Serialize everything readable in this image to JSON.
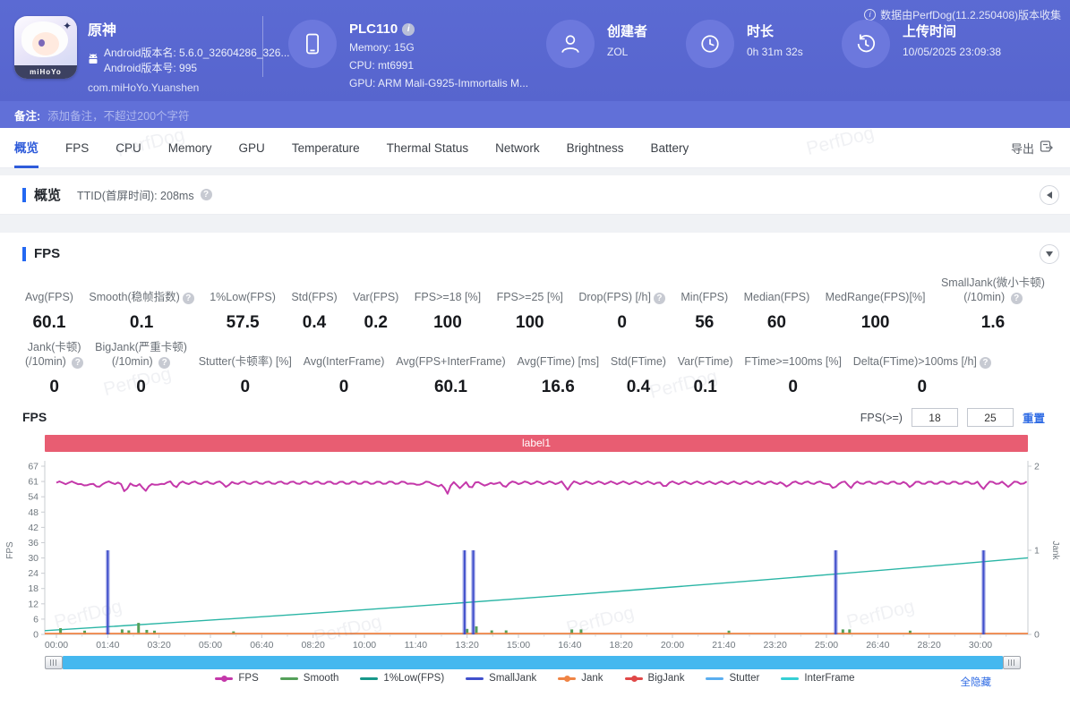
{
  "header": {
    "app": {
      "name": "原神",
      "version_name": "Android版本名: 5.6.0_32604286_326...",
      "version_code": "Android版本号: 995",
      "package": "com.miHoYo.Yuanshen",
      "icon_text": "miHoYo"
    },
    "device": {
      "name": "PLC110",
      "memory": "Memory: 15G",
      "cpu": "CPU: mt6991",
      "gpu": "GPU: ARM Mali-G925-Immortalis M..."
    },
    "creator": {
      "label": "创建者",
      "value": "ZOL"
    },
    "duration": {
      "label": "时长",
      "value": "0h 31m 32s"
    },
    "upload_time": {
      "label": "上传时间",
      "value": "10/05/2025 23:09:38"
    },
    "version_note": "数据由PerfDog(11.2.250408)版本收集"
  },
  "note_bar": {
    "label": "备注:",
    "placeholder": "添加备注，不超过200个字符"
  },
  "tab_bar": {
    "tabs": [
      "概览",
      "FPS",
      "CPU",
      "Memory",
      "GPU",
      "Temperature",
      "Thermal Status",
      "Network",
      "Brightness",
      "Battery"
    ],
    "export_label": "导出"
  },
  "overview": {
    "title": "概览",
    "ttid": "TTID(首屏时间): 208ms"
  },
  "fps": {
    "title": "FPS",
    "chart_title": "FPS",
    "threshold_label": "FPS(>=)",
    "threshold1": "18",
    "threshold2": "25",
    "reset_label": "重置",
    "banner": "label1",
    "hide_all": "全隐藏",
    "metrics_row1": [
      {
        "label": "Avg(FPS)",
        "value": "60.1"
      },
      {
        "label": "Smooth(稳帧指数)",
        "value": "0.1",
        "help": true
      },
      {
        "label": "1%Low(FPS)",
        "value": "57.5"
      },
      {
        "label": "Std(FPS)",
        "value": "0.4"
      },
      {
        "label": "Var(FPS)",
        "value": "0.2"
      },
      {
        "label": "FPS>=18 [%]",
        "value": "100"
      },
      {
        "label": "FPS>=25 [%]",
        "value": "100"
      },
      {
        "label": "Drop(FPS) [/h]",
        "value": "0",
        "help": true
      },
      {
        "label": "Min(FPS)",
        "value": "56"
      },
      {
        "label": "Median(FPS)",
        "value": "60"
      },
      {
        "label": "MedRange(FPS)[%]",
        "value": "100"
      },
      {
        "label": "SmallJank(微小卡顿)",
        "label2": "(/10min)",
        "value": "1.6",
        "help": true
      }
    ],
    "metrics_row2": [
      {
        "label": "Jank(卡顿)",
        "label2": "(/10min)",
        "value": "0",
        "help": true
      },
      {
        "label": "BigJank(严重卡顿)",
        "label2": "(/10min)",
        "value": "0",
        "help": true
      },
      {
        "label": "Stutter(卡顿率) [%]",
        "value": "0"
      },
      {
        "label": "Avg(InterFrame)",
        "value": "0"
      },
      {
        "label": "Avg(FPS+InterFrame)",
        "value": "60.1"
      },
      {
        "label": "Avg(FTime) [ms]",
        "value": "16.6"
      },
      {
        "label": "Std(FTime)",
        "value": "0.4"
      },
      {
        "label": "Var(FTime)",
        "value": "0.1"
      },
      {
        "label": "FTime>=100ms [%]",
        "value": "0"
      },
      {
        "label": "Delta(FTime)>100ms [/h]",
        "value": "0",
        "help": true
      }
    ]
  },
  "chart_data": {
    "type": "line",
    "title": "label1",
    "x_ticks": [
      "00:00",
      "01:40",
      "03:20",
      "05:00",
      "06:40",
      "08:20",
      "10:00",
      "11:40",
      "13:20",
      "15:00",
      "16:40",
      "18:20",
      "20:00",
      "21:40",
      "23:20",
      "25:00",
      "26:40",
      "28:20",
      "30:00"
    ],
    "x_seconds_per_tick": 100,
    "x_total_seconds": 1892,
    "y_left": {
      "label": "FPS",
      "ticks": [
        0,
        6,
        12,
        18,
        24,
        30,
        36,
        42,
        48,
        54,
        61,
        67
      ],
      "max": 67
    },
    "y_right": {
      "label": "Jank",
      "ticks": [
        0,
        1,
        2
      ],
      "max": 2
    },
    "series": {
      "fps": {
        "name": "FPS",
        "color": "#c438aa",
        "baseline": 60.4,
        "dips": [
          [
            55,
            58.6
          ],
          [
            80,
            57.9
          ],
          [
            133,
            56.8
          ],
          [
            152,
            58.4
          ],
          [
            173,
            56.2
          ],
          [
            196,
            58.8
          ],
          [
            232,
            58.9
          ],
          [
            333,
            58.8
          ],
          [
            700,
            59.0
          ],
          [
            745,
            58.3
          ],
          [
            762,
            56.3
          ],
          [
            788,
            58.0
          ],
          [
            808,
            58.5
          ],
          [
            838,
            58.9
          ],
          [
            872,
            58.6
          ],
          [
            995,
            57.9
          ],
          [
            1183,
            59.0
          ],
          [
            1420,
            58.8
          ],
          [
            1513,
            57.6
          ],
          [
            1548,
            58.8
          ],
          [
            1661,
            58.9
          ],
          [
            1804,
            57.8
          ],
          [
            1852,
            58.9
          ]
        ]
      },
      "smooth": {
        "name": "Smooth",
        "color": "#55a05a",
        "avg": 0.1,
        "bars": [
          [
            8,
            2.5
          ],
          [
            55,
            1.5
          ],
          [
            128,
            2.0
          ],
          [
            141,
            1.6
          ],
          [
            160,
            4.6
          ],
          [
            176,
            1.8
          ],
          [
            191,
            1.5
          ],
          [
            345,
            1.2
          ],
          [
            800,
            2.2
          ],
          [
            818,
            3.2
          ],
          [
            848,
            1.6
          ],
          [
            876,
            1.6
          ],
          [
            1004,
            2.0
          ],
          [
            1022,
            2.0
          ],
          [
            1310,
            1.5
          ],
          [
            1532,
            2.0
          ],
          [
            1545,
            2.0
          ],
          [
            1663,
            1.5
          ]
        ]
      },
      "low1pct": {
        "name": "1%Low(FPS)",
        "color": "#2ab5a5",
        "trend_start": 1.5,
        "trend_end": 30.5
      },
      "smalljank": {
        "name": "SmallJank",
        "color": "#4150cc",
        "events": [
          100,
          795,
          812,
          1518,
          1806
        ],
        "event_value": 1
      },
      "jank": {
        "name": "Jank",
        "color": "#f08445",
        "constant": 0
      },
      "bigjank": {
        "name": "BigJank",
        "color": "#e04848",
        "constant": 0
      },
      "stutter": {
        "name": "Stutter",
        "color": "#5aaef0",
        "constant": 0
      },
      "interframe": {
        "name": "InterFrame",
        "color": "#35cfd4",
        "constant": 0
      }
    },
    "legend": [
      {
        "name": "FPS",
        "color": "#c438aa",
        "dot": true
      },
      {
        "name": "Smooth",
        "color": "#55a05a",
        "dot": false
      },
      {
        "name": "1%Low(FPS)",
        "color": "#17988a",
        "dot": false
      },
      {
        "name": "SmallJank",
        "color": "#4150cc",
        "dot": false
      },
      {
        "name": "Jank",
        "color": "#f08445",
        "dot": true
      },
      {
        "name": "BigJank",
        "color": "#e04848",
        "dot": true
      },
      {
        "name": "Stutter",
        "color": "#5aaef0",
        "dot": false
      },
      {
        "name": "InterFrame",
        "color": "#35cfd4",
        "dot": false
      }
    ]
  },
  "watermark": "PerfDog"
}
